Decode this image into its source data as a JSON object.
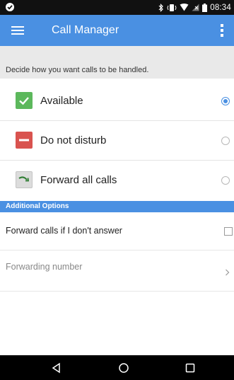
{
  "status_bar": {
    "time": "08:34",
    "icons": [
      "app-notification-icon",
      "bluetooth-icon",
      "vibrate-icon",
      "wifi-icon",
      "no-signal-icon",
      "battery-icon"
    ]
  },
  "app_bar": {
    "title": "Call Manager",
    "menu_icon": "hamburger-menu-icon",
    "overflow_icon": "overflow-menu-icon",
    "color": "#4a90e2"
  },
  "subheader": {
    "text": "Decide how you want calls to be handled."
  },
  "options": [
    {
      "label": "Available",
      "icon": "check-icon",
      "icon_color": "#5cb85c",
      "selected": true
    },
    {
      "label": "Do not disturb",
      "icon": "minus-icon",
      "icon_color": "#d9534f",
      "selected": false
    },
    {
      "label": "Forward all calls",
      "icon": "forward-arrow-icon",
      "icon_color": "#dddddd",
      "selected": false
    }
  ],
  "additional": {
    "header": "Additional Options",
    "forward_if_no_answer": {
      "label": "Forward calls if I don't answer",
      "checked": false
    },
    "forwarding_number": {
      "label": "Forwarding number"
    }
  },
  "nav_bar": {
    "icons": [
      "back-triangle-icon",
      "home-circle-icon",
      "recents-square-icon"
    ]
  }
}
